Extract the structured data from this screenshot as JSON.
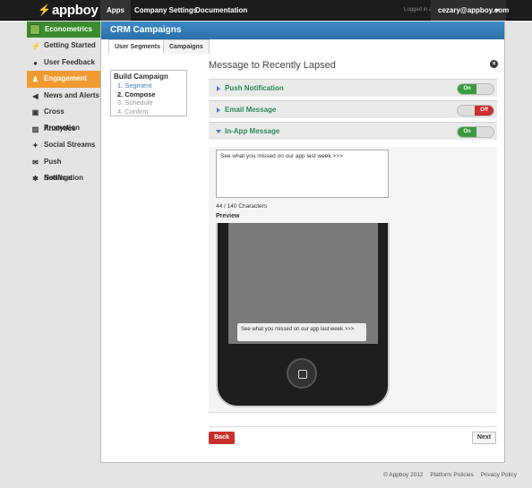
{
  "topnav": {
    "logo": "appboy",
    "items": [
      {
        "label": "Apps",
        "active": true
      },
      {
        "label": "Company Settings",
        "active": false
      },
      {
        "label": "Documentation",
        "active": false
      }
    ],
    "logged_in_text": "Logged in as",
    "user": "cezary@appboy.com"
  },
  "sidebar": {
    "app_name": "Econometrics",
    "items": [
      {
        "label": "Getting Started",
        "icon": "bolt-icon",
        "glyph": "⚡"
      },
      {
        "label": "User Feedback",
        "icon": "chat-icon",
        "glyph": "●"
      },
      {
        "label": "Engagement",
        "icon": "users-icon",
        "glyph": "♟",
        "active": true
      },
      {
        "label": "News and Alerts",
        "icon": "megaphone-icon",
        "glyph": "◀"
      },
      {
        "label": "Cross Promotion",
        "icon": "cart-icon",
        "glyph": "▣"
      },
      {
        "label": "Analytics",
        "icon": "chart-icon",
        "glyph": "▥"
      },
      {
        "label": "Social Streams",
        "icon": "bird-icon",
        "glyph": "✦"
      },
      {
        "label": "Push Notification",
        "icon": "envelope-icon",
        "glyph": "✉"
      },
      {
        "label": "Settings",
        "icon": "gear-icon",
        "glyph": "✱"
      }
    ]
  },
  "main": {
    "title": "CRM Campaigns",
    "tabs": [
      {
        "label": "User Segments",
        "active": true
      },
      {
        "label": "Campaigns",
        "active": false
      }
    ],
    "steps": {
      "title": "Build Campaign",
      "items": [
        "1. Segment",
        "2. Compose",
        "3. Schedule",
        "4. Confirm"
      ]
    },
    "message_title": "Message to Recently Lapsed",
    "channels": [
      {
        "label": "Push Notification",
        "state": "On",
        "expanded": false
      },
      {
        "label": "Email Message",
        "state": "Off",
        "expanded": false
      },
      {
        "label": "In-App Message",
        "state": "On",
        "expanded": true
      }
    ],
    "message_text": "See what you missed on our app last week >>>",
    "char_count": "44 / 140 Characters",
    "preview_label": "Preview",
    "preview_text": "See what you missed on our app last week >>>",
    "back_label": "Back",
    "next_label": "Next"
  },
  "footer": {
    "copyright": "© Appboy 2012",
    "links": [
      "Platform Policies",
      "Privacy Policy"
    ]
  },
  "colors": {
    "brand_green": "#7fc241",
    "header_blue": "#2c6fa8",
    "active_orange": "#f09b32",
    "on_green": "#3a9a3f",
    "off_red": "#c9302c"
  }
}
